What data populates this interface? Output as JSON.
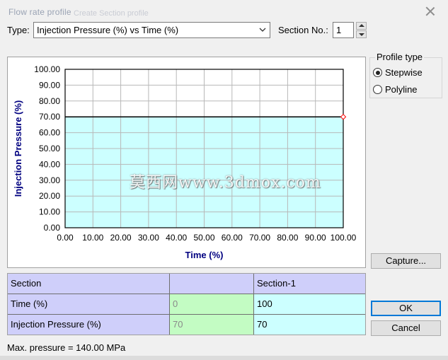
{
  "window": {
    "title": "Flow rate profile",
    "ghost_title": "Create Section profile"
  },
  "type_row": {
    "label": "Type:",
    "selected": "Injection Pressure (%) vs Time (%)",
    "section_label": "Section No.:",
    "section_value": "1"
  },
  "profile_type": {
    "legend": "Profile type",
    "options": [
      {
        "label": "Stepwise",
        "checked": true
      },
      {
        "label": "Polyline",
        "checked": false
      }
    ]
  },
  "buttons": {
    "capture": "Capture...",
    "ok": "OK",
    "cancel": "Cancel"
  },
  "table": {
    "headers": [
      "Section",
      "",
      "Section-1"
    ],
    "rows": [
      {
        "label": "Time (%)",
        "start": "0",
        "end": "100"
      },
      {
        "label": "Injection Pressure (%)",
        "start": "70",
        "end": "70"
      }
    ]
  },
  "status": {
    "max_pressure": "Max. pressure = 140.00 MPa"
  },
  "watermark": "莫西网www.3dmox.com",
  "colors": {
    "fill": "#ccffff",
    "header": "#cfcffa",
    "green_cell": "#c3fcc3",
    "axis_label": "#000080",
    "marker": "#ff0000"
  },
  "chart_data": {
    "type": "area",
    "step": true,
    "xlabel": "Time (%)",
    "ylabel": "Injection Pressure (%)",
    "xlim": [
      0,
      100
    ],
    "ylim": [
      0,
      100
    ],
    "xticks": [
      0,
      10,
      20,
      30,
      40,
      50,
      60,
      70,
      80,
      90,
      100
    ],
    "yticks": [
      0,
      10,
      20,
      30,
      40,
      50,
      60,
      70,
      80,
      90,
      100
    ],
    "grid": true,
    "series": [
      {
        "x": [
          0,
          100
        ],
        "y": [
          70,
          70
        ]
      }
    ]
  }
}
